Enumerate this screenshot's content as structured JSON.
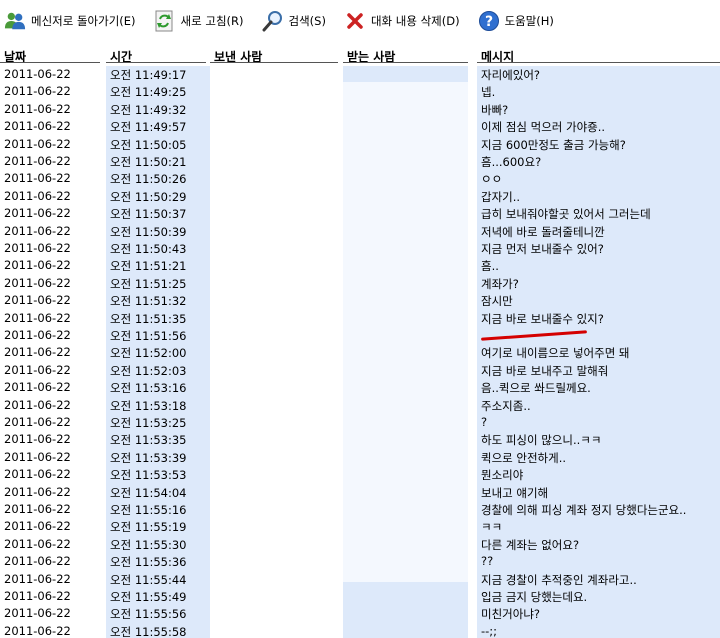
{
  "toolbar": {
    "items": [
      {
        "label": "메신저로 돌아가기(E)",
        "icon": "messenger-users-icon"
      },
      {
        "label": "새로 고침(R)",
        "icon": "refresh-icon"
      },
      {
        "label": "검색(S)",
        "icon": "magnifier-icon"
      },
      {
        "label": "대화 내용 삭제(D)",
        "icon": "delete-x-icon"
      },
      {
        "label": "도움말(H)",
        "icon": "help-icon"
      }
    ]
  },
  "columns": {
    "date": "날짜",
    "time": "시간",
    "sender": "보낸 사람",
    "receiver": "받는 사람",
    "message": "메시지"
  },
  "colors": {
    "band": "#dde9fa",
    "strike": "#d40000"
  },
  "rows": [
    {
      "date": "2011-06-22",
      "time": "오전 11:49:17",
      "message": "자리에있어?"
    },
    {
      "date": "2011-06-22",
      "time": "오전 11:49:25",
      "message": "넵."
    },
    {
      "date": "2011-06-22",
      "time": "오전 11:49:32",
      "message": "바빠?"
    },
    {
      "date": "2011-06-22",
      "time": "오전 11:49:57",
      "message": "이제 점심 먹으러 가야죵.."
    },
    {
      "date": "2011-06-22",
      "time": "오전 11:50:05",
      "message": "지금 600만정도 출금 가능해?"
    },
    {
      "date": "2011-06-22",
      "time": "오전 11:50:21",
      "message": "흠...600요?"
    },
    {
      "date": "2011-06-22",
      "time": "오전 11:50:26",
      "message": "ㅇㅇ"
    },
    {
      "date": "2011-06-22",
      "time": "오전 11:50:29",
      "message": "갑자기.."
    },
    {
      "date": "2011-06-22",
      "time": "오전 11:50:37",
      "message": "급히 보내줘야할곳 있어서 그러는데"
    },
    {
      "date": "2011-06-22",
      "time": "오전 11:50:39",
      "message": "저녁에 바로 돌려줄테니깐"
    },
    {
      "date": "2011-06-22",
      "time": "오전 11:50:43",
      "message": "지금 먼저 보내줄수 있어?"
    },
    {
      "date": "2011-06-22",
      "time": "오전 11:51:21",
      "message": "흠.."
    },
    {
      "date": "2011-06-22",
      "time": "오전 11:51:25",
      "message": "계좌가?"
    },
    {
      "date": "2011-06-22",
      "time": "오전 11:51:32",
      "message": "잠시만"
    },
    {
      "date": "2011-06-22",
      "time": "오전 11:51:35",
      "message": "지금 바로 보내줄수 있지?"
    },
    {
      "date": "2011-06-22",
      "time": "오전 11:51:56",
      "message": "",
      "struck": true
    },
    {
      "date": "2011-06-22",
      "time": "오전 11:52:00",
      "message": "여기로 내이름으로 넣어주면 돼"
    },
    {
      "date": "2011-06-22",
      "time": "오전 11:52:03",
      "message": "지금 바로 보내주고 말해줘"
    },
    {
      "date": "2011-06-22",
      "time": "오전 11:53:16",
      "message": "음..퀵으로 쏴드릴께요."
    },
    {
      "date": "2011-06-22",
      "time": "오전 11:53:18",
      "message": "주소지좀.."
    },
    {
      "date": "2011-06-22",
      "time": "오전 11:53:25",
      "message": "?"
    },
    {
      "date": "2011-06-22",
      "time": "오전 11:53:35",
      "message": "하도 피싱이 많으니..ㅋㅋ"
    },
    {
      "date": "2011-06-22",
      "time": "오전 11:53:39",
      "message": "퀵으로 안전하게.."
    },
    {
      "date": "2011-06-22",
      "time": "오전 11:53:53",
      "message": "뭔소리야"
    },
    {
      "date": "2011-06-22",
      "time": "오전 11:54:04",
      "message": "보내고 얘기해"
    },
    {
      "date": "2011-06-22",
      "time": "오전 11:55:16",
      "message": "경찰에 의해 피싱 계좌 정지 당했다는군요.."
    },
    {
      "date": "2011-06-22",
      "time": "오전 11:55:19",
      "message": "ㅋㅋ"
    },
    {
      "date": "2011-06-22",
      "time": "오전 11:55:30",
      "message": "다른 계좌는 없어요?"
    },
    {
      "date": "2011-06-22",
      "time": "오전 11:55:36",
      "message": "??"
    },
    {
      "date": "2011-06-22",
      "time": "오전 11:55:44",
      "message": "지금 경찰이 추적중인 계좌라고.."
    },
    {
      "date": "2011-06-22",
      "time": "오전 11:55:49",
      "message": "입금 금지 당했는데요."
    },
    {
      "date": "2011-06-22",
      "time": "오전 11:55:56",
      "message": "미친거아냐?"
    },
    {
      "date": "2011-06-22",
      "time": "오전 11:55:58",
      "message": "--;;"
    }
  ]
}
